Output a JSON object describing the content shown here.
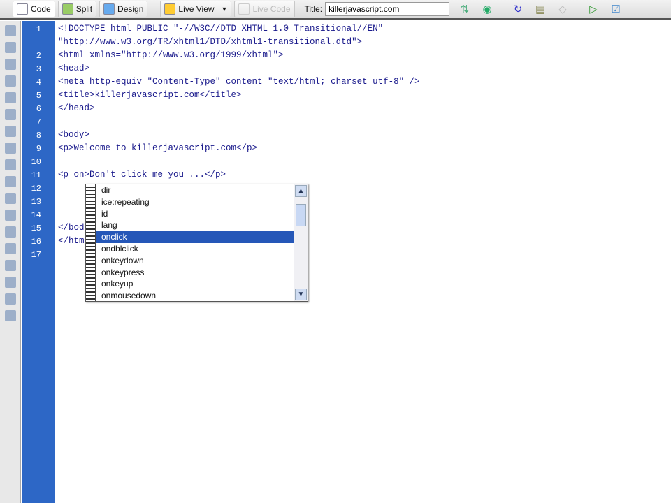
{
  "toolbar": {
    "code": "Code",
    "split": "Split",
    "design": "Design",
    "live_view": "Live View",
    "live_code": "Live Code",
    "title_label": "Title:",
    "title_value": "killerjavascript.com"
  },
  "editor": {
    "lines": [
      {
        "n": "1",
        "t": "<!DOCTYPE html PUBLIC \"-//W3C//DTD XHTML 1.0 Transitional//EN\""
      },
      {
        "n": "",
        "t": "\"http://www.w3.org/TR/xhtml1/DTD/xhtml1-transitional.dtd\">"
      },
      {
        "n": "2",
        "t": "<html xmlns=\"http://www.w3.org/1999/xhtml\">"
      },
      {
        "n": "3",
        "t": "<head>"
      },
      {
        "n": "4",
        "t": "<meta http-equiv=\"Content-Type\" content=\"text/html; charset=utf-8\" />"
      },
      {
        "n": "5",
        "t": "<title>killerjavascript.com</title>"
      },
      {
        "n": "6",
        "t": "</head>"
      },
      {
        "n": "7",
        "t": ""
      },
      {
        "n": "8",
        "t": "<body>"
      },
      {
        "n": "9",
        "t": "<p>Welcome to killerjavascript.com</p>"
      },
      {
        "n": "10",
        "t": ""
      },
      {
        "n": "11",
        "t": "<p on>Don't click me you ...</p>"
      },
      {
        "n": "12",
        "t": ""
      },
      {
        "n": "13",
        "t": ""
      },
      {
        "n": "14",
        "t": ""
      },
      {
        "n": "15",
        "t": "</body>"
      },
      {
        "n": "16",
        "t": "</html>"
      },
      {
        "n": "17",
        "t": ""
      }
    ]
  },
  "autocomplete": {
    "items": [
      "dir",
      "ice:repeating",
      "id",
      "lang",
      "onclick",
      "ondblclick",
      "onkeydown",
      "onkeypress",
      "onkeyup",
      "onmousedown"
    ],
    "selected": "onclick"
  }
}
